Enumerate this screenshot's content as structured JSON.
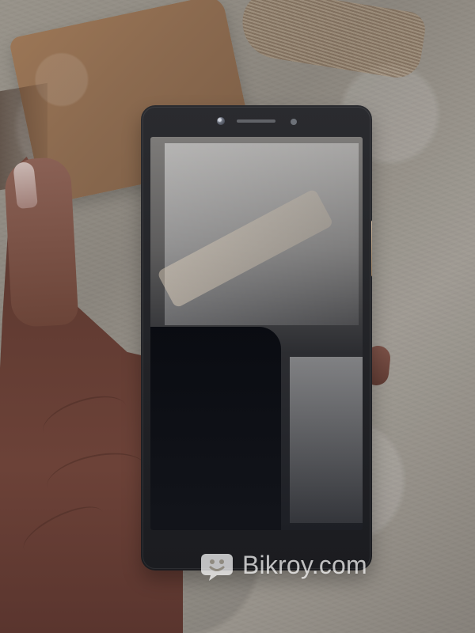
{
  "image": {
    "watermark": {
      "text": "Bikroy.com",
      "logo_icon": "chat-bubble-smile-icon",
      "color": "#FFFFFF"
    }
  }
}
